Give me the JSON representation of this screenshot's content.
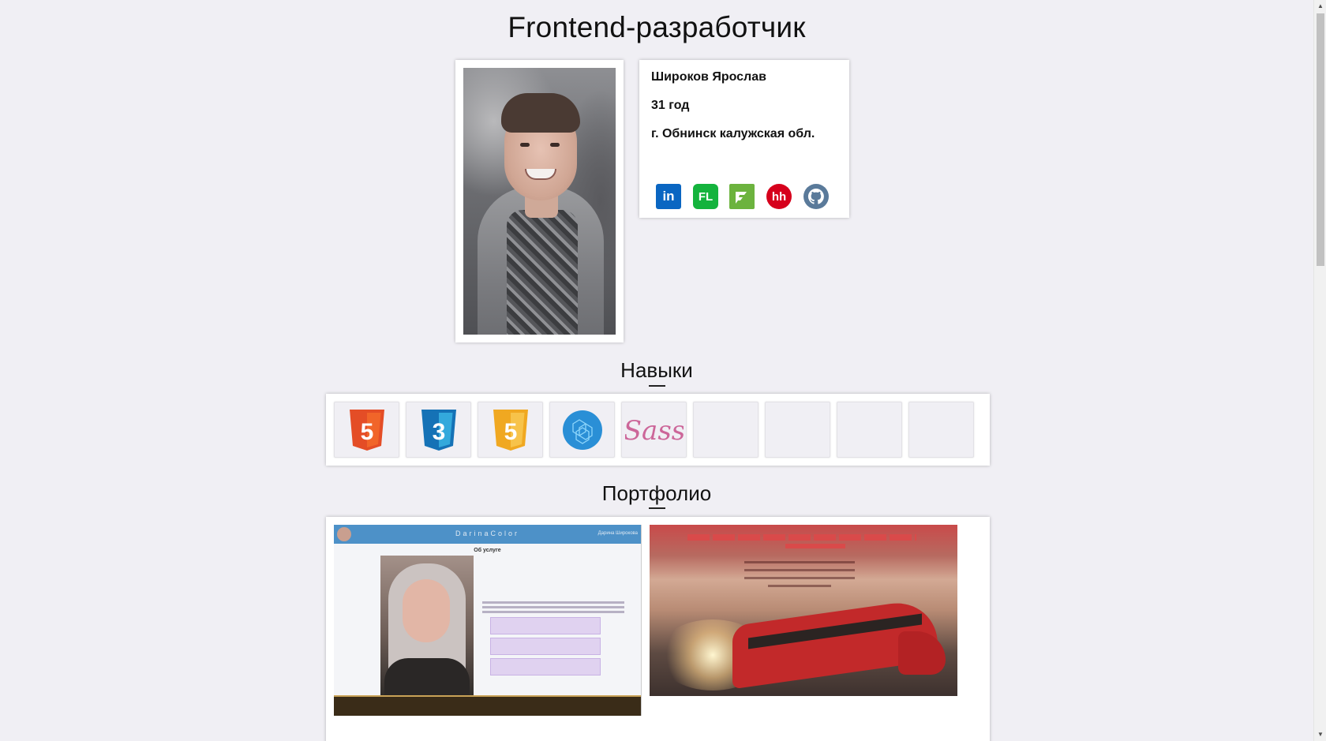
{
  "header": {
    "title": "Frontend-разработчик"
  },
  "profile": {
    "photo_alt": "",
    "name": "Широков Ярослав",
    "age": "31 год",
    "city": "г. Обнинск калужская обл."
  },
  "socials": [
    {
      "name": "linkedin-icon",
      "label": "in"
    },
    {
      "name": "fl-icon",
      "label": "FL"
    },
    {
      "name": "freelance-icon",
      "label": ""
    },
    {
      "name": "hh-icon",
      "label": "hh"
    },
    {
      "name": "github-icon",
      "label": ""
    }
  ],
  "skills": {
    "title": "Навыки",
    "items": [
      {
        "icon": "html5-icon",
        "number": "5",
        "color": "#e44d26"
      },
      {
        "icon": "css3-icon",
        "number": "3",
        "color": "#1572b6"
      },
      {
        "icon": "javascript-icon",
        "number": "5",
        "color": "#f0a821"
      },
      {
        "icon": "webpack-icon",
        "color": "#2a8fd6"
      },
      {
        "icon": "sass-icon",
        "label": "Sass",
        "color": "#cc6699"
      },
      {
        "icon": "empty-skill"
      },
      {
        "icon": "empty-skill"
      },
      {
        "icon": "empty-skill"
      },
      {
        "icon": "empty-skill"
      }
    ]
  },
  "portfolio": {
    "title": "Портфолио",
    "projects": [
      {
        "brand": "DarinaColor",
        "brand_right": "Дарина Широкова",
        "heading": "Об услуге"
      },
      {
        "name": "railway-project"
      }
    ]
  },
  "colors": {
    "background": "#f0eff4",
    "card": "#ffffff"
  }
}
